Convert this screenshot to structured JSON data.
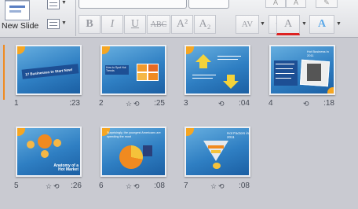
{
  "ribbon": {
    "new_slide_label": "New Slide",
    "font_buttons": [
      "B",
      "I",
      "U",
      "ABC",
      "A²",
      "A₂"
    ],
    "spacing_label": "AV"
  },
  "slides": [
    {
      "number": "1",
      "time": ":23",
      "title": "17 Businesses to Start Now!",
      "has_star": false,
      "has_transition": false
    },
    {
      "number": "2",
      "time": ":25",
      "title": "How to Spot Hot Trends",
      "has_star": true,
      "has_transition": true
    },
    {
      "number": "3",
      "time": ":04",
      "title": "",
      "has_star": false,
      "has_transition": true
    },
    {
      "number": "4",
      "time": ":18",
      "title": "Hot Business in 2011",
      "has_star": false,
      "has_transition": true
    },
    {
      "number": "5",
      "time": ":26",
      "title": "Anatomy of a Hot Market",
      "has_star": true,
      "has_transition": true
    },
    {
      "number": "6",
      "time": ":08",
      "title": "Surprisingly, the youngest Americans are spending the most",
      "has_star": true,
      "has_transition": true
    },
    {
      "number": "7",
      "time": ":08",
      "title": "Hot Factors in 2011",
      "has_star": true,
      "has_transition": true
    }
  ],
  "icons": {
    "star": "animation-star-icon",
    "transition": "transition-icon"
  }
}
